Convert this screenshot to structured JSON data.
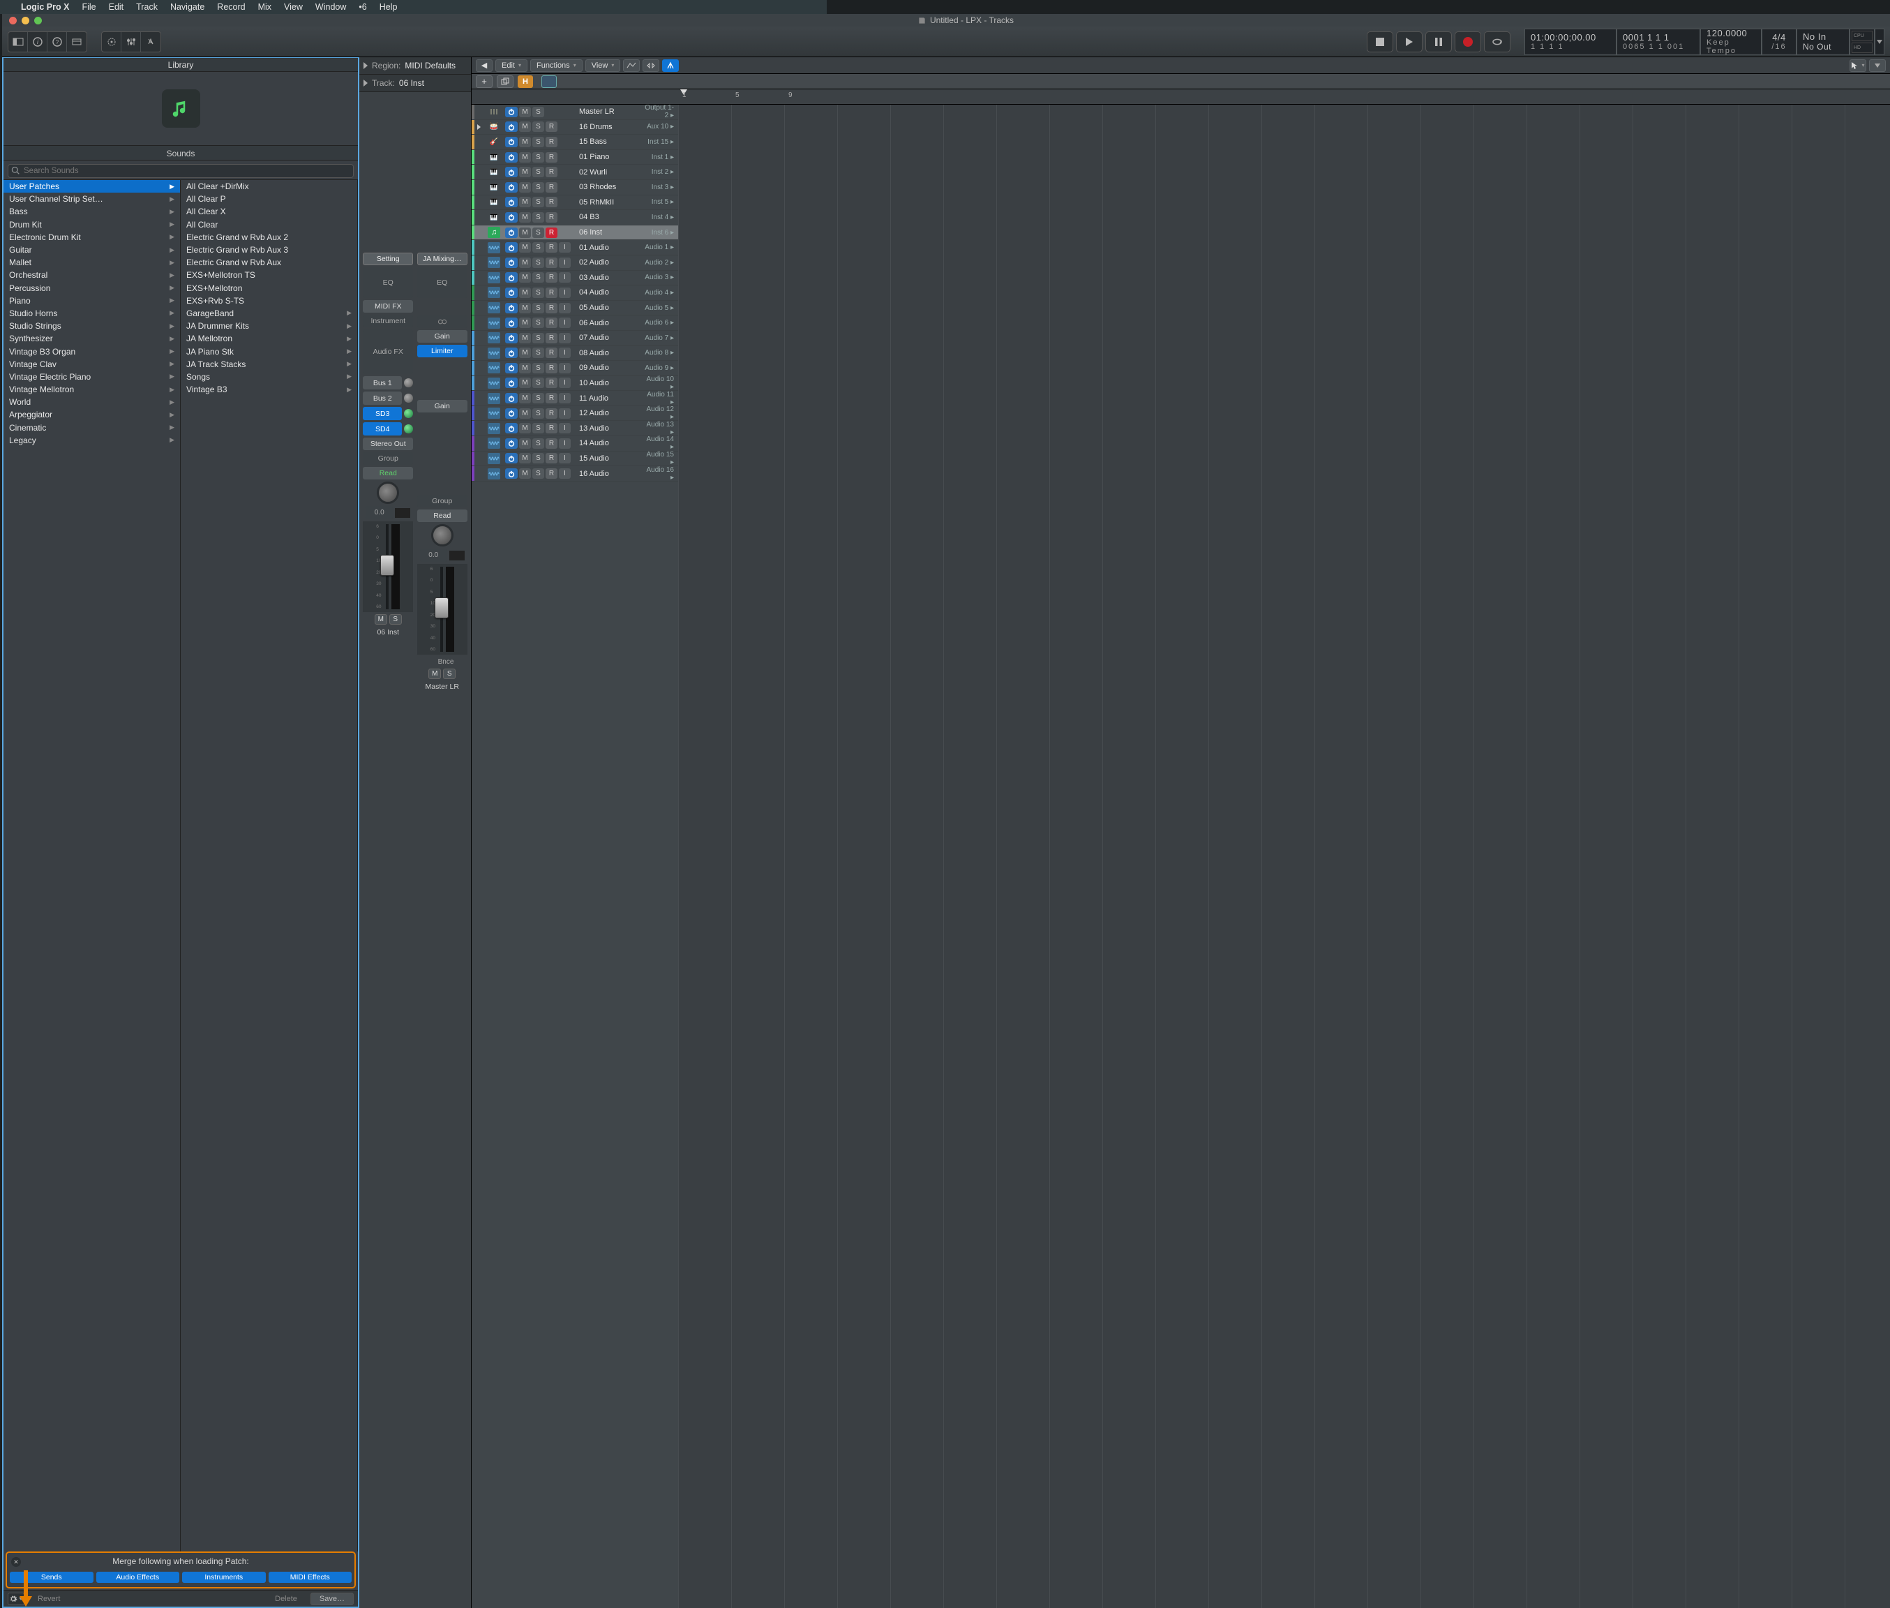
{
  "menubar": {
    "apple": "",
    "app": "Logic Pro X",
    "items": [
      "File",
      "Edit",
      "Track",
      "Navigate",
      "Record",
      "Mix",
      "View",
      "Window",
      "•6",
      "Help"
    ]
  },
  "window": {
    "title": "Untitled - LPX - Tracks"
  },
  "lcd": {
    "smpte": "01:00:00;00.00",
    "smpte_sub": "1  1  1     1",
    "bars": "0001 1 1   1",
    "bars_sub": "0065 1 1   001",
    "tempo": "120.0000",
    "tempo_label": "Keep Tempo",
    "sig_top": "4/4",
    "sig_bot": "/16",
    "io_top": "No In",
    "io_bot": "No Out",
    "meter_top": "CPU",
    "meter_bot": "HD"
  },
  "library": {
    "title": "Library",
    "sounds": "Sounds",
    "search_ph": "Search Sounds",
    "cats": [
      {
        "t": "User Patches",
        "sel": true
      },
      {
        "t": "User Channel Strip Set…"
      },
      {
        "t": "Bass"
      },
      {
        "t": "Drum Kit"
      },
      {
        "t": "Electronic Drum Kit"
      },
      {
        "t": "Guitar"
      },
      {
        "t": "Mallet"
      },
      {
        "t": "Orchestral"
      },
      {
        "t": "Percussion"
      },
      {
        "t": "Piano"
      },
      {
        "t": "Studio Horns"
      },
      {
        "t": "Studio Strings"
      },
      {
        "t": "Synthesizer"
      },
      {
        "t": "Vintage B3 Organ"
      },
      {
        "t": "Vintage Clav"
      },
      {
        "t": "Vintage Electric Piano"
      },
      {
        "t": "Vintage Mellotron"
      },
      {
        "t": "World"
      },
      {
        "t": "Arpeggiator"
      },
      {
        "t": "Cinematic"
      },
      {
        "t": "Legacy"
      }
    ],
    "items": [
      {
        "t": "All Clear +DirMix"
      },
      {
        "t": "All Clear P"
      },
      {
        "t": "All Clear X"
      },
      {
        "t": "All Clear"
      },
      {
        "t": "Electric Grand w Rvb Aux 2"
      },
      {
        "t": "Electric Grand w Rvb Aux 3"
      },
      {
        "t": "Electric Grand w Rvb Aux"
      },
      {
        "t": "EXS+Mellotron TS"
      },
      {
        "t": "EXS+Mellotron"
      },
      {
        "t": "EXS+Rvb S-TS"
      },
      {
        "t": "GarageBand",
        "arrow": true
      },
      {
        "t": "JA Drummer Kits",
        "arrow": true
      },
      {
        "t": "JA Mellotron",
        "arrow": true
      },
      {
        "t": "JA Piano Stk",
        "arrow": true
      },
      {
        "t": "JA Track Stacks",
        "arrow": true
      },
      {
        "t": "Songs",
        "arrow": true
      },
      {
        "t": "Vintage B3",
        "arrow": true
      }
    ],
    "merge": {
      "title": "Merge following when loading Patch:",
      "buttons": [
        "Sends",
        "Audio Effects",
        "Instruments",
        "MIDI Effects"
      ]
    },
    "footer": {
      "revert": "Revert",
      "delete": "Delete",
      "save": "Save…"
    }
  },
  "inspector": {
    "region_label": "Region:",
    "region_val": "MIDI Defaults",
    "track_label": "Track:",
    "track_val": "06 Inst",
    "stripA": {
      "setting": "Setting",
      "eq": "EQ",
      "midifx": "MIDI FX",
      "inst": "Instrument",
      "audiofx": "Audio FX",
      "sends": [
        "Bus 1",
        "Bus 2",
        "SD3",
        "SD4"
      ],
      "stereo": "Stereo Out",
      "group": "Group",
      "read": "Read",
      "pan": "0.0",
      "ms": [
        "M",
        "S"
      ],
      "name": "06 Inst"
    },
    "stripB": {
      "setting": "JA Mixing…",
      "eq": "EQ",
      "gain": "Gain",
      "limiter": "Limiter",
      "group": "Group",
      "read": "Read",
      "pan": "0.0",
      "bnce": "Bnce",
      "ms": [
        "M",
        "S"
      ],
      "name": "Master LR"
    }
  },
  "tracks": {
    "toolbar": {
      "edit": "Edit",
      "functions": "Functions",
      "view": "View"
    },
    "ruler": [
      "1",
      "5",
      "9"
    ],
    "rows": [
      {
        "name": "Master LR",
        "out": "Output 1-2",
        "color": "#6a6a6a",
        "icon": "sliders",
        "master": true
      },
      {
        "name": "16 Drums",
        "out": "Aux 10",
        "color": "#d9a24b",
        "icon": "drums",
        "r": true,
        "disc": true
      },
      {
        "name": "15 Bass",
        "out": "Inst 15",
        "color": "#d9a24b",
        "icon": "bass",
        "r": true
      },
      {
        "name": "01 Piano",
        "out": "Inst 1",
        "color": "#5adf7d",
        "icon": "piano",
        "r": true
      },
      {
        "name": "02 Wurli",
        "out": "Inst 2",
        "color": "#5adf7d",
        "icon": "keys",
        "r": true
      },
      {
        "name": "03 Rhodes",
        "out": "Inst 3",
        "color": "#5adf7d",
        "icon": "keys",
        "r": true
      },
      {
        "name": "05 RhMkII",
        "out": "Inst 5",
        "color": "#5adf7d",
        "icon": "keys",
        "r": true
      },
      {
        "name": "04 B3",
        "out": "Inst 4",
        "color": "#5adf7d",
        "icon": "organ",
        "r": true
      },
      {
        "name": "06 Inst",
        "out": "Inst 6",
        "color": "#5adf7d",
        "icon": "note",
        "r": true,
        "armed": true,
        "sel": true
      },
      {
        "name": "01 Audio",
        "out": "Audio 1",
        "color": "#4ec8c0",
        "icon": "audio",
        "r": true,
        "i": true
      },
      {
        "name": "02 Audio",
        "out": "Audio 2",
        "color": "#4ec8c0",
        "icon": "audio",
        "r": true,
        "i": true
      },
      {
        "name": "03 Audio",
        "out": "Audio 3",
        "color": "#4ec8c0",
        "icon": "audio",
        "r": true,
        "i": true
      },
      {
        "name": "04 Audio",
        "out": "Audio 4",
        "color": "#2f9a53",
        "icon": "audio",
        "r": true,
        "i": true
      },
      {
        "name": "05 Audio",
        "out": "Audio 5",
        "color": "#2f9a53",
        "icon": "audio",
        "r": true,
        "i": true
      },
      {
        "name": "06 Audio",
        "out": "Audio 6",
        "color": "#2f9a53",
        "icon": "audio",
        "r": true,
        "i": true
      },
      {
        "name": "07 Audio",
        "out": "Audio 7",
        "color": "#4da0dc",
        "icon": "audio",
        "r": true,
        "i": true
      },
      {
        "name": "08 Audio",
        "out": "Audio 8",
        "color": "#4da0dc",
        "icon": "audio",
        "r": true,
        "i": true
      },
      {
        "name": "09 Audio",
        "out": "Audio 9",
        "color": "#4da0dc",
        "icon": "audio",
        "r": true,
        "i": true
      },
      {
        "name": "10 Audio",
        "out": "Audio 10",
        "color": "#4da0dc",
        "icon": "audio",
        "r": true,
        "i": true
      },
      {
        "name": "11 Audio",
        "out": "Audio 11",
        "color": "#4f55cf",
        "icon": "audio",
        "r": true,
        "i": true
      },
      {
        "name": "12 Audio",
        "out": "Audio 12",
        "color": "#4f55cf",
        "icon": "audio",
        "r": true,
        "i": true
      },
      {
        "name": "13 Audio",
        "out": "Audio 13",
        "color": "#4f55cf",
        "icon": "audio",
        "r": true,
        "i": true
      },
      {
        "name": "14 Audio",
        "out": "Audio 14",
        "color": "#7c3fbd",
        "icon": "audio",
        "r": true,
        "i": true
      },
      {
        "name": "15 Audio",
        "out": "Audio 15",
        "color": "#7c3fbd",
        "icon": "audio",
        "r": true,
        "i": true
      },
      {
        "name": "16 Audio",
        "out": "Audio 16",
        "color": "#7c3fbd",
        "icon": "audio",
        "r": true,
        "i": true
      }
    ]
  }
}
